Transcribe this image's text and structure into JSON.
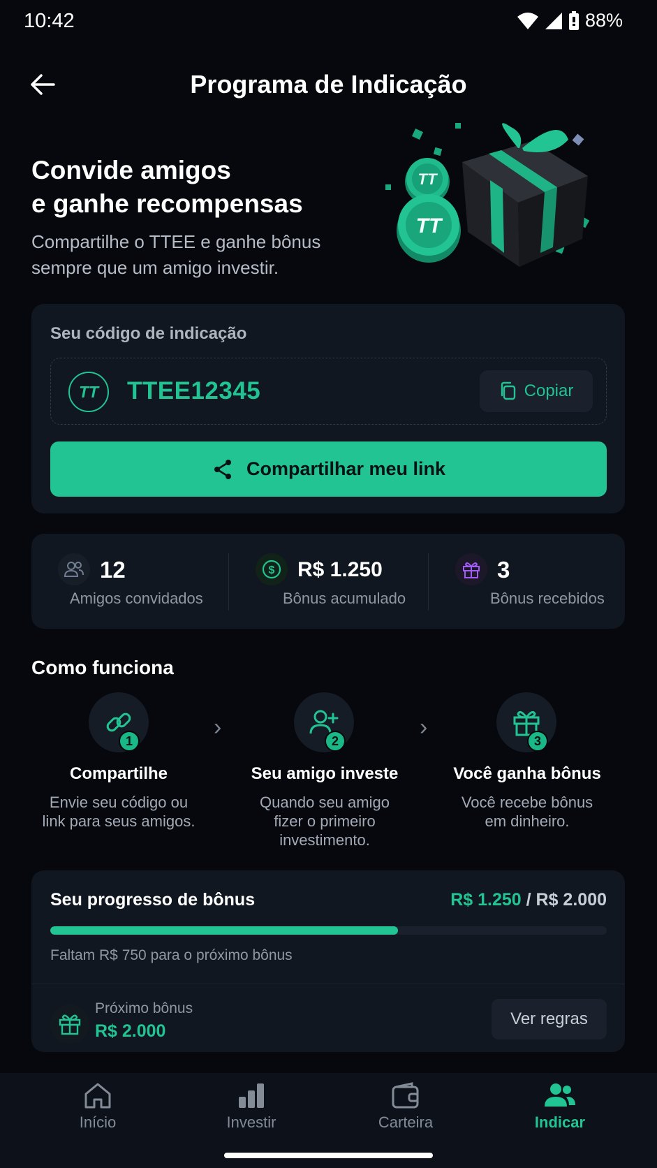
{
  "status_bar": {
    "time": "10:42",
    "battery": "88%"
  },
  "header": {
    "title": "Programa de Indicação"
  },
  "hero": {
    "title_line1": "Convide amigos",
    "title_line2": "e ganhe recompensas",
    "subtitle_line1": "Compartilhe o TTEE e ganhe bônus",
    "subtitle_line2": "sempre que um amigo investir."
  },
  "referral": {
    "label": "Seu código de indicação",
    "logo_text": "TT",
    "code": "TTEE12345",
    "copy_label": "Copiar",
    "share_label": "Compartilhar meu link"
  },
  "stats": [
    {
      "value": "12",
      "label": "Amigos convidados",
      "icon": "users-icon",
      "color": "#6f7e93"
    },
    {
      "value": "R$ 1.250",
      "label": "Bônus acumulado",
      "icon": "dollar-icon",
      "color": "#22c493"
    },
    {
      "value": "3",
      "label": "Bônus recebidos",
      "icon": "gift-icon",
      "color": "#a35cf5"
    }
  ],
  "how_it_works": {
    "title": "Como funciona",
    "steps": [
      {
        "num": "1",
        "title": "Compartilhe",
        "desc_line1": "Envie seu código ou",
        "desc_line2": "link para seus amigos.",
        "desc_line3": ""
      },
      {
        "num": "2",
        "title": "Seu amigo investe",
        "desc_line1": "Quando seu amigo",
        "desc_line2": "fizer o primeiro",
        "desc_line3": "investimento."
      },
      {
        "num": "3",
        "title": "Você ganha bônus",
        "desc_line1": "Você recebe bônus",
        "desc_line2": "em dinheiro.",
        "desc_line3": ""
      }
    ]
  },
  "progress": {
    "title": "Seu progresso de bônus",
    "current": "R$ 1.250",
    "separator": " / ",
    "target": "R$ 2.000",
    "fraction": 0.625,
    "note": "Faltam R$ 750 para o próximo bônus",
    "next_label": "Próximo bônus",
    "next_value": "R$ 2.000",
    "rules_label": "Ver regras"
  },
  "nav": [
    {
      "label": "Início",
      "icon": "home-icon",
      "active": false
    },
    {
      "label": "Investir",
      "icon": "bar-chart-icon",
      "active": false
    },
    {
      "label": "Carteira",
      "icon": "wallet-icon",
      "active": false
    },
    {
      "label": "Indicar",
      "icon": "people-icon",
      "active": true
    }
  ],
  "colors": {
    "accent": "#22c493",
    "background": "#06080d",
    "card": "#111720"
  }
}
